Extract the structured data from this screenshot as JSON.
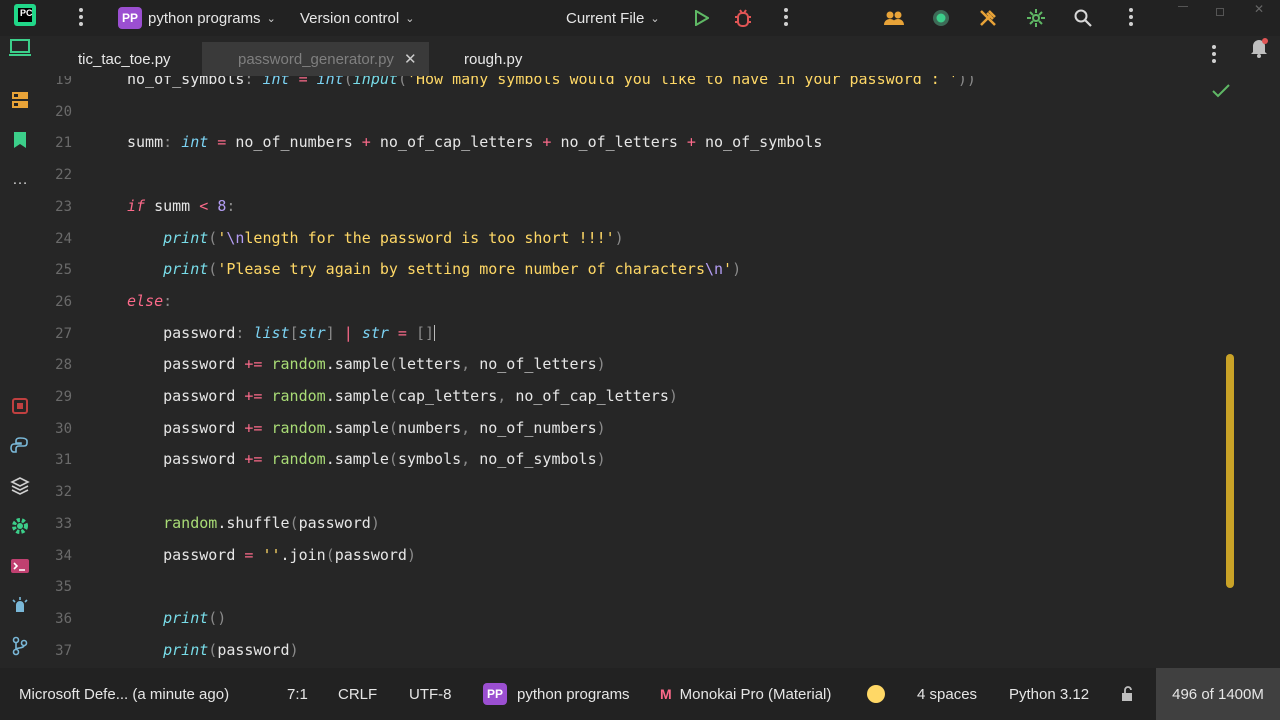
{
  "titlebar": {
    "project_badge": "PP",
    "project_name": "python programs",
    "version_control": "Version control",
    "run_config": "Current File"
  },
  "tabs": [
    {
      "label": "tic_tac_toe.py"
    },
    {
      "label": "password_generator.py",
      "active": true
    },
    {
      "label": "rough.py"
    }
  ],
  "editor": {
    "lines": [
      {
        "num": "19",
        "tokens": [
          [
            "no_of_symbols",
            "id"
          ],
          [
            ": ",
            "pn"
          ],
          [
            "int",
            "ty"
          ],
          [
            " = ",
            "op"
          ],
          [
            "int",
            "ty"
          ],
          [
            "(",
            "pn"
          ],
          [
            "input",
            "bi"
          ],
          [
            "(",
            "pn"
          ],
          [
            "'How many symbols would you like to have in your password : '",
            "st"
          ],
          [
            "))",
            "pn"
          ]
        ]
      },
      {
        "num": "20",
        "tokens": []
      },
      {
        "num": "21",
        "tokens": [
          [
            "summ",
            "id"
          ],
          [
            ": ",
            "pn"
          ],
          [
            "int",
            "ty"
          ],
          [
            " = ",
            "op"
          ],
          [
            "no_of_numbers",
            "id"
          ],
          [
            " + ",
            "op"
          ],
          [
            "no_of_cap_letters",
            "id"
          ],
          [
            " + ",
            "op"
          ],
          [
            "no_of_letters",
            "id"
          ],
          [
            " + ",
            "op"
          ],
          [
            "no_of_symbols",
            "id"
          ]
        ]
      },
      {
        "num": "22",
        "tokens": []
      },
      {
        "num": "23",
        "tokens": [
          [
            "if",
            "kw"
          ],
          [
            " summ ",
            "id"
          ],
          [
            "<",
            "op"
          ],
          [
            " ",
            "id"
          ],
          [
            "8",
            "nm"
          ],
          [
            ":",
            "pn"
          ]
        ]
      },
      {
        "num": "24",
        "tokens": [
          [
            "    ",
            "id"
          ],
          [
            "print",
            "bi"
          ],
          [
            "(",
            "pn"
          ],
          [
            "'",
            "st"
          ],
          [
            "\\n",
            "nm"
          ],
          [
            "length for the password is too short !!!'",
            "st"
          ],
          [
            ")",
            "pn"
          ]
        ]
      },
      {
        "num": "25",
        "tokens": [
          [
            "    ",
            "id"
          ],
          [
            "print",
            "bi"
          ],
          [
            "(",
            "pn"
          ],
          [
            "'Please try again by setting more number of characters",
            "st"
          ],
          [
            "\\n",
            "nm"
          ],
          [
            "'",
            "st"
          ],
          [
            ")",
            "pn"
          ]
        ]
      },
      {
        "num": "26",
        "tokens": [
          [
            "else",
            "kw"
          ],
          [
            ":",
            "pn"
          ]
        ]
      },
      {
        "num": "27",
        "tokens": [
          [
            "    password",
            "id"
          ],
          [
            ": ",
            "pn"
          ],
          [
            "list",
            "ty"
          ],
          [
            "[",
            "pn"
          ],
          [
            "str",
            "ty"
          ],
          [
            "] ",
            "pn"
          ],
          [
            "| ",
            "op"
          ],
          [
            "str",
            "ty"
          ],
          [
            " = ",
            "op"
          ],
          [
            "[]",
            "pn"
          ]
        ],
        "caret": true
      },
      {
        "num": "28",
        "tokens": [
          [
            "    password ",
            "id"
          ],
          [
            "+=",
            "op"
          ],
          [
            " ",
            "id"
          ],
          [
            "random",
            "md"
          ],
          [
            ".sample",
            "id"
          ],
          [
            "(",
            "pn"
          ],
          [
            "letters",
            "id"
          ],
          [
            ", ",
            "pn"
          ],
          [
            "no_of_letters",
            "id"
          ],
          [
            ")",
            "pn"
          ]
        ]
      },
      {
        "num": "29",
        "tokens": [
          [
            "    password ",
            "id"
          ],
          [
            "+=",
            "op"
          ],
          [
            " ",
            "id"
          ],
          [
            "random",
            "md"
          ],
          [
            ".sample",
            "id"
          ],
          [
            "(",
            "pn"
          ],
          [
            "cap_letters",
            "id"
          ],
          [
            ", ",
            "pn"
          ],
          [
            "no_of_cap_letters",
            "id"
          ],
          [
            ")",
            "pn"
          ]
        ]
      },
      {
        "num": "30",
        "tokens": [
          [
            "    password ",
            "id"
          ],
          [
            "+=",
            "op"
          ],
          [
            " ",
            "id"
          ],
          [
            "random",
            "md"
          ],
          [
            ".sample",
            "id"
          ],
          [
            "(",
            "pn"
          ],
          [
            "numbers",
            "id"
          ],
          [
            ", ",
            "pn"
          ],
          [
            "no_of_numbers",
            "id"
          ],
          [
            ")",
            "pn"
          ]
        ]
      },
      {
        "num": "31",
        "tokens": [
          [
            "    password ",
            "id"
          ],
          [
            "+=",
            "op"
          ],
          [
            " ",
            "id"
          ],
          [
            "random",
            "md"
          ],
          [
            ".sample",
            "id"
          ],
          [
            "(",
            "pn"
          ],
          [
            "symbols",
            "id"
          ],
          [
            ", ",
            "pn"
          ],
          [
            "no_of_symbols",
            "id"
          ],
          [
            ")",
            "pn"
          ]
        ]
      },
      {
        "num": "32",
        "tokens": []
      },
      {
        "num": "33",
        "tokens": [
          [
            "    ",
            "id"
          ],
          [
            "random",
            "md"
          ],
          [
            ".shuffle",
            "id"
          ],
          [
            "(",
            "pn"
          ],
          [
            "password",
            "id"
          ],
          [
            ")",
            "pn"
          ]
        ]
      },
      {
        "num": "34",
        "tokens": [
          [
            "    password ",
            "id"
          ],
          [
            "=",
            "op"
          ],
          [
            " ",
            "id"
          ],
          [
            "''",
            "st"
          ],
          [
            ".join",
            "id"
          ],
          [
            "(",
            "pn"
          ],
          [
            "password",
            "id"
          ],
          [
            ")",
            "pn"
          ]
        ]
      },
      {
        "num": "35",
        "tokens": []
      },
      {
        "num": "36",
        "tokens": [
          [
            "    ",
            "id"
          ],
          [
            "print",
            "bi"
          ],
          [
            "()",
            "pn"
          ]
        ]
      },
      {
        "num": "37",
        "tokens": [
          [
            "    ",
            "id"
          ],
          [
            "print",
            "bi"
          ],
          [
            "(",
            "pn"
          ],
          [
            "password",
            "id"
          ],
          [
            ")",
            "pn"
          ]
        ]
      }
    ]
  },
  "statusbar": {
    "notification": "Microsoft Defe... (a minute ago)",
    "position": "7:1",
    "line_endings": "CRLF",
    "encoding": "UTF-8",
    "project_badge": "PP",
    "project_name": "python programs",
    "theme": "Monokai Pro (Material)",
    "indent": "4 spaces",
    "interpreter": "Python 3.12",
    "memory": "496 of 1400M"
  },
  "colors": {
    "background": "#262626",
    "accent_project": "#9b4fd1",
    "scrollbar": "#c9a227",
    "keyword": "#fc6a8a",
    "string": "#ffd866",
    "number": "#b39df3",
    "type": "#7cd3f3"
  },
  "icons": {
    "run": "play-icon",
    "debug": "bug-icon",
    "search": "search-icon",
    "notifications": "bell-icon",
    "inspection_ok": "checkmark-icon"
  }
}
